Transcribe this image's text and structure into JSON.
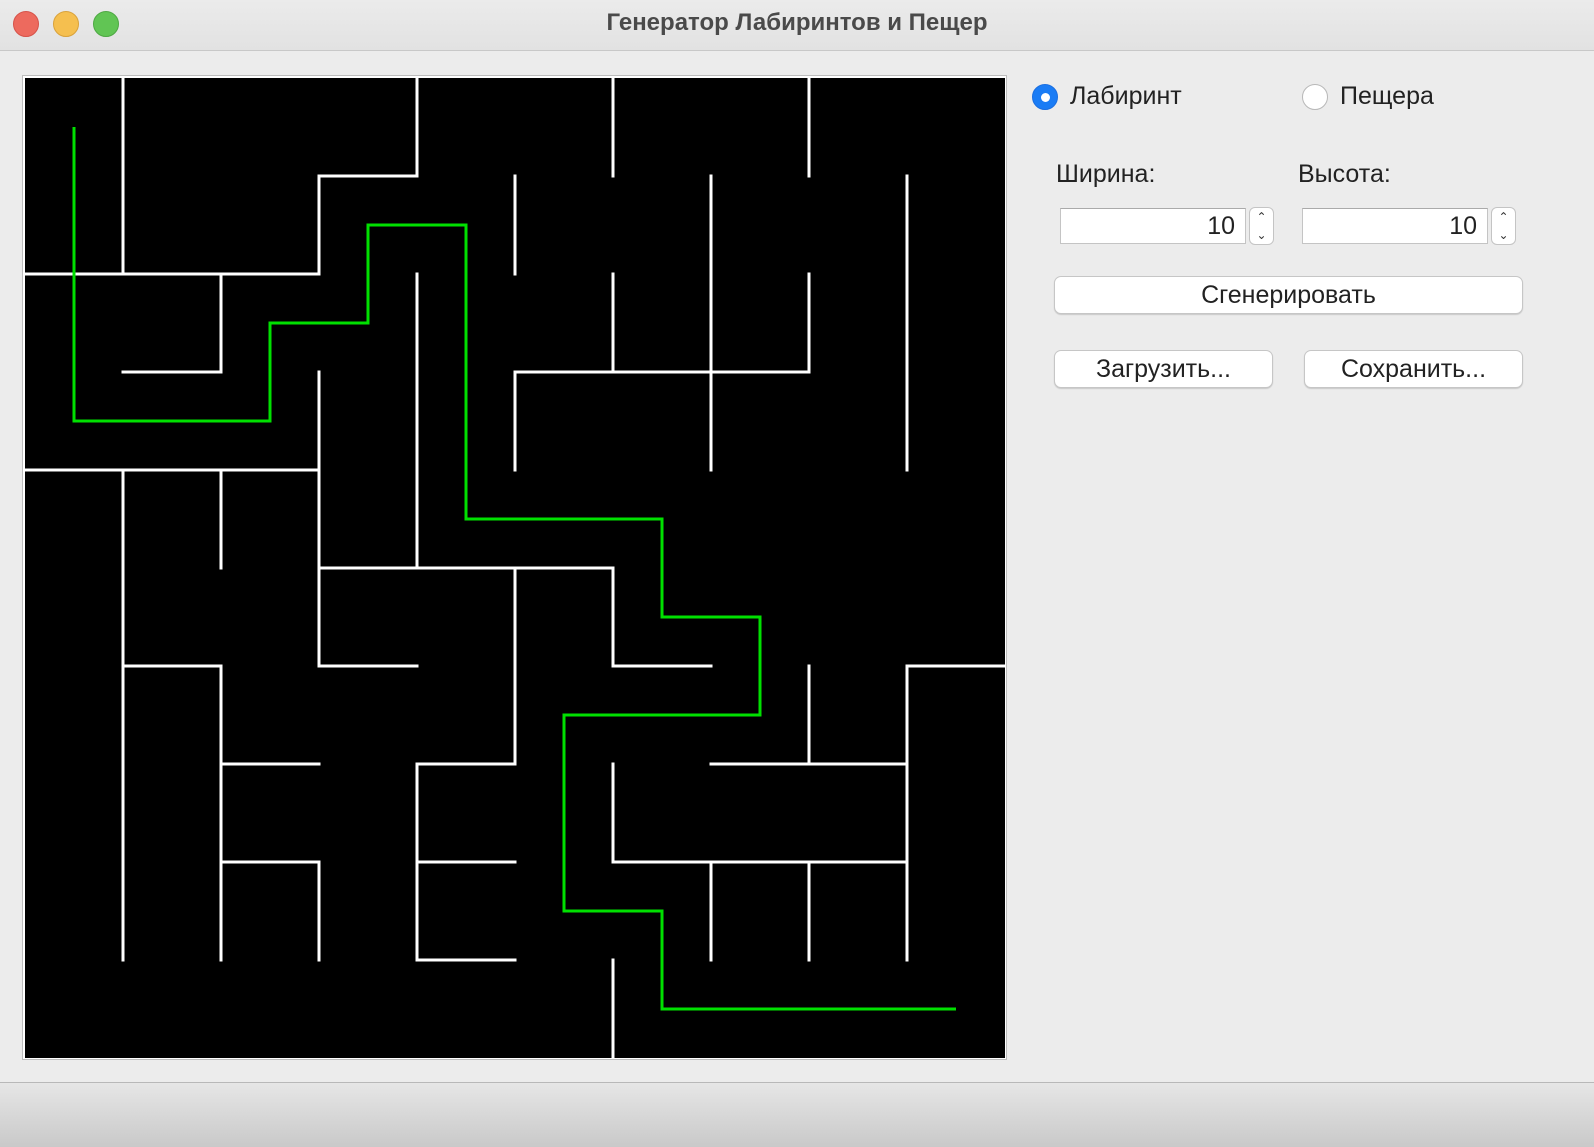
{
  "window": {
    "title": "Генератор Лабиринтов и Пещер"
  },
  "mode": {
    "options": [
      {
        "label": "Лабиринт",
        "selected": true
      },
      {
        "label": "Пещера",
        "selected": false
      }
    ]
  },
  "size": {
    "width_label": "Ширина:",
    "width_value": "10",
    "height_label": "Высота:",
    "height_value": "10"
  },
  "buttons": {
    "generate": "Сгенерировать",
    "load": "Загрузить...",
    "save": "Сохранить..."
  },
  "maze": {
    "rows": 10,
    "cols": 10,
    "colors": {
      "background": "#000000",
      "wall": "#ffffff",
      "path": "#00e000"
    },
    "h_walls": [
      [
        0,
        1,
        2,
        1
      ],
      [
        3,
        4,
        1,
        1
      ],
      [
        1,
        2,
        2,
        1
      ],
      [
        1,
        2,
        3,
        1
      ],
      [
        1,
        3,
        2,
        1
      ],
      [
        5,
        8,
        3,
        1
      ],
      [
        0,
        3,
        4,
        1
      ],
      [
        3,
        6,
        5,
        1
      ],
      [
        1,
        2,
        6,
        1
      ],
      [
        3,
        4,
        6,
        1
      ],
      [
        6,
        7,
        6,
        1
      ],
      [
        9,
        10,
        6,
        1
      ],
      [
        2,
        3,
        7,
        1
      ],
      [
        4,
        5,
        7,
        1
      ],
      [
        7,
        9,
        7,
        1
      ],
      [
        2,
        3,
        8,
        1
      ],
      [
        4,
        5,
        8,
        1
      ],
      [
        6,
        9,
        8,
        1
      ],
      [
        4,
        5,
        9,
        1
      ]
    ],
    "v_walls": [
      [
        1,
        0,
        2,
        1
      ],
      [
        4,
        0,
        1,
        1
      ],
      [
        6,
        0,
        1,
        1
      ],
      [
        8,
        0,
        1,
        1
      ],
      [
        3,
        1,
        2,
        1
      ],
      [
        5,
        1,
        2,
        1
      ],
      [
        7,
        1,
        4,
        1
      ],
      [
        9,
        1,
        4,
        1
      ],
      [
        2,
        2,
        3,
        1
      ],
      [
        4,
        2,
        5,
        1
      ],
      [
        6,
        2,
        3,
        1
      ],
      [
        8,
        2,
        3,
        1
      ],
      [
        3,
        3,
        6,
        1
      ],
      [
        5,
        3,
        4,
        1
      ],
      [
        1,
        4,
        9,
        1
      ],
      [
        2,
        4,
        5,
        1
      ],
      [
        3,
        5,
        6,
        1
      ],
      [
        5,
        5,
        7,
        1
      ],
      [
        6,
        5,
        6,
        1
      ],
      [
        2,
        6,
        9,
        1
      ],
      [
        8,
        6,
        7,
        1
      ],
      [
        9,
        6,
        9,
        1
      ],
      [
        4,
        7,
        9,
        1
      ],
      [
        6,
        7,
        8,
        1
      ],
      [
        3,
        8,
        9,
        1
      ],
      [
        7,
        8,
        9,
        1
      ],
      [
        8,
        8,
        9,
        1
      ],
      [
        6,
        9,
        10,
        1
      ]
    ],
    "path": [
      [
        0,
        0
      ],
      [
        0,
        1
      ],
      [
        0,
        2
      ],
      [
        0,
        3
      ],
      [
        1,
        3
      ],
      [
        2,
        3
      ],
      [
        2,
        2
      ],
      [
        3,
        2
      ],
      [
        3,
        1
      ],
      [
        4,
        1
      ],
      [
        4,
        2
      ],
      [
        4,
        3
      ],
      [
        4,
        4
      ],
      [
        5,
        4
      ],
      [
        6,
        4
      ],
      [
        6,
        5
      ],
      [
        7,
        5
      ],
      [
        7,
        6
      ],
      [
        6,
        6
      ],
      [
        5,
        6
      ],
      [
        5,
        7
      ],
      [
        5,
        8
      ],
      [
        6,
        8
      ],
      [
        6,
        9
      ],
      [
        7,
        9
      ],
      [
        8,
        9
      ],
      [
        9,
        9
      ]
    ]
  }
}
